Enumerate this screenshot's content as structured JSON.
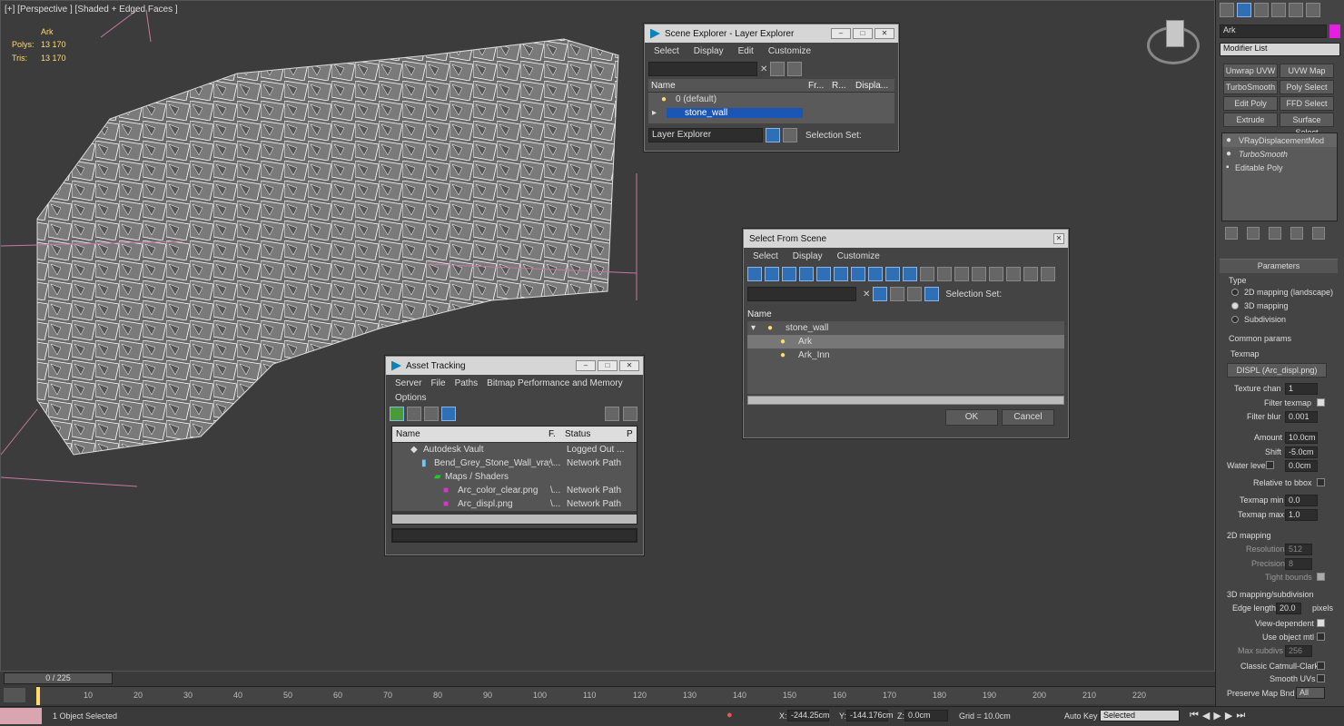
{
  "viewport": {
    "label": "[+] [Perspective ] [Shaded + Edged Faces ]",
    "obj_name": "Ark",
    "polys_label": "Polys:",
    "polys": "13 170",
    "tris_label": "Tris:",
    "tris": "13 170"
  },
  "scene_explorer": {
    "title": "Scene Explorer - Layer Explorer",
    "menu": [
      "Select",
      "Display",
      "Edit",
      "Customize"
    ],
    "headers": [
      "Name",
      "Fr...",
      "R...",
      "Displa..."
    ],
    "rows": [
      "0 (default)",
      "stone_wall"
    ],
    "footer_dropdown": "Layer Explorer",
    "selection_set": "Selection Set:"
  },
  "select_from_scene": {
    "title": "Select From Scene",
    "menu": [
      "Select",
      "Display",
      "Customize"
    ],
    "selection_set": "Selection Set:",
    "header": "Name",
    "rows": [
      "stone_wall",
      "Ark",
      "Ark_Inn"
    ],
    "ok": "OK",
    "cancel": "Cancel"
  },
  "asset_tracking": {
    "title": "Asset Tracking",
    "menu": [
      "Server",
      "File",
      "Paths",
      "Bitmap Performance and Memory"
    ],
    "menu2": "Options",
    "headers": [
      "Name",
      "F.",
      "Status",
      "P"
    ],
    "rows": [
      {
        "name": "Autodesk Vault",
        "f": "",
        "status": "Logged Out ..."
      },
      {
        "name": "Bend_Grey_Stone_Wall_vray....",
        "f": "\\...",
        "status": "Network Path"
      },
      {
        "name": "Maps / Shaders",
        "f": "",
        "status": ""
      },
      {
        "name": "Arc_color_clear.png",
        "f": "\\...",
        "status": "Network Path"
      },
      {
        "name": "Arc_displ.png",
        "f": "\\...",
        "status": "Network Path"
      }
    ]
  },
  "command_panel": {
    "object_name": "Ark",
    "modifier_list": "Modifier List",
    "buttons": [
      "Unwrap UVW",
      "UVW Map",
      "TurboSmooth",
      "Poly Select",
      "Edit Poly",
      "FFD Select",
      "Extrude",
      "Surface Select"
    ],
    "stack": [
      "VRayDisplacementMod",
      "TurboSmooth",
      "Editable Poly"
    ],
    "rollout": "Parameters",
    "type_label": "Type",
    "types": [
      "2D mapping (landscape)",
      "3D mapping",
      "Subdivision"
    ],
    "common": "Common params",
    "texmap_label": "Texmap",
    "texmap": "DISPL (Arc_displ.png)",
    "texture_chan_label": "Texture chan",
    "texture_chan": "1",
    "filter_texmap": "Filter texmap",
    "filter_blur_label": "Filter blur",
    "filter_blur": "0.001",
    "amount_label": "Amount",
    "amount": "10.0cm",
    "shift_label": "Shift",
    "shift": "-5.0cm",
    "water_label": "Water level",
    "water": "0.0cm",
    "relative": "Relative to bbox",
    "texmap_min_label": "Texmap min",
    "texmap_min": "0.0",
    "texmap_max_label": "Texmap max",
    "texmap_max": "1.0",
    "map2d": "2D mapping",
    "resolution_label": "Resolution",
    "resolution": "512",
    "precision_label": "Precision",
    "precision": "8",
    "tight": "Tight bounds",
    "map3d": "3D mapping/subdivision",
    "edge_label": "Edge length",
    "edge": "20.0",
    "pixels": "pixels",
    "view_dep": "View-dependent",
    "use_obj": "Use object mtl",
    "max_subdivs_label": "Max subdivs",
    "max_subdivs": "256",
    "catmull": "Classic Catmull-Clark",
    "smooth_uv": "Smooth UVs",
    "preserve_label": "Preserve Map Bnd",
    "preserve": "All"
  },
  "timeline": {
    "frame": "0 / 225",
    "ticks": [
      "10",
      "20",
      "30",
      "40",
      "50",
      "60",
      "70",
      "80",
      "90",
      "100",
      "110",
      "120",
      "130",
      "140",
      "150",
      "160",
      "170",
      "180",
      "190",
      "200",
      "210",
      "220"
    ]
  },
  "status": {
    "selected": "1 Object Selected",
    "x_label": "X:",
    "x": "-244.25cm",
    "y_label": "Y:",
    "y": "-144.176cm",
    "z_label": "Z:",
    "z": "0.0cm",
    "grid": "Grid = 10.0cm",
    "auto_key": "Auto Key",
    "key_mode": "Selected"
  }
}
